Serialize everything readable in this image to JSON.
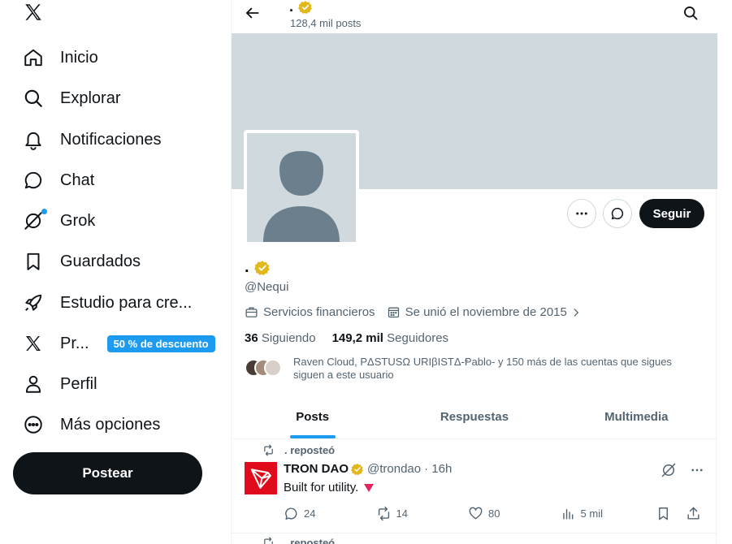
{
  "sidebar": {
    "items": [
      {
        "label": "Inicio",
        "icon": "home-icon"
      },
      {
        "label": "Explorar",
        "icon": "search-icon"
      },
      {
        "label": "Notificaciones",
        "icon": "bell-icon"
      },
      {
        "label": "Chat",
        "icon": "chat-icon"
      },
      {
        "label": "Grok",
        "icon": "grok-icon"
      },
      {
        "label": "Guardados",
        "icon": "bookmark-icon"
      },
      {
        "label": "Estudio para cre...",
        "icon": "rocket-icon"
      },
      {
        "label": "Pr...",
        "icon": "x-logo-icon",
        "badge": "50 % de descuento"
      },
      {
        "label": "Perfil",
        "icon": "person-icon"
      },
      {
        "label": "Más opciones",
        "icon": "more-circle-icon"
      }
    ],
    "post_button": "Postear"
  },
  "header": {
    "name": ".",
    "posts_count": "128,4 mil posts"
  },
  "profile": {
    "name": ".",
    "handle": "@Nequi",
    "category": "Servicios financieros",
    "joined": "Se unió el noviembre de 2015",
    "following_count": "36",
    "following_label": "Siguiendo",
    "followers_count": "149,2 mil",
    "followers_label": "Seguidores",
    "known_followers_line1": "Raven Cloud, PΔSTUSΩ URIβISTΔ-Ᵽablo- y 150 más de las cuentas que sigues",
    "known_followers_line2": "siguen a este usuario",
    "follow_button": "Seguir",
    "verified_color": "#e2b719"
  },
  "tabs": [
    {
      "label": "Posts",
      "active": true
    },
    {
      "label": "Respuestas",
      "active": false
    },
    {
      "label": "Multimedia",
      "active": false
    }
  ],
  "posts": [
    {
      "repost_label": ". reposteó",
      "author": "TRON DAO",
      "handle": "@trondao",
      "time": "· 16h",
      "text": "Built for utility.",
      "replies": "24",
      "reposts": "14",
      "likes": "80",
      "views": "5 mil"
    }
  ],
  "next_post": {
    "repost_label": ". reposteó"
  },
  "colors": {
    "accent": "#1d9bf0",
    "dark": "#0f1419",
    "muted": "#536471",
    "banner": "#cfd9de",
    "tron_red": "#e00c1c"
  }
}
